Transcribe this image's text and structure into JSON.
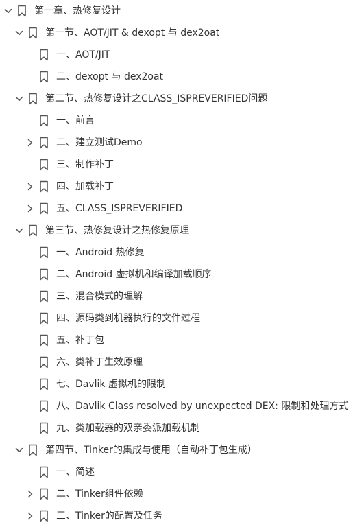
{
  "outline": {
    "items": [
      {
        "label": "第一章、热修复设计",
        "level": 0,
        "toggle": "expanded"
      },
      {
        "label": "第一节、AOT/JIT & dexopt 与 dex2oat",
        "level": 1,
        "toggle": "expanded"
      },
      {
        "label": "一、AOT/JIT",
        "level": 2,
        "toggle": "none"
      },
      {
        "label": "二、dexopt 与 dex2oat",
        "level": 2,
        "toggle": "none"
      },
      {
        "label": "第二节、热修复设计之CLASS_ISPREVERIFIED问题",
        "level": 1,
        "toggle": "expanded"
      },
      {
        "label": "一、前言",
        "level": 2,
        "toggle": "none",
        "underlined": true
      },
      {
        "label": "二、建立测试Demo",
        "level": 2,
        "toggle": "collapsed"
      },
      {
        "label": "三、制作补丁",
        "level": 2,
        "toggle": "none"
      },
      {
        "label": "四、加载补丁",
        "level": 2,
        "toggle": "collapsed"
      },
      {
        "label": "五、CLASS_ISPREVERIFIED",
        "level": 2,
        "toggle": "collapsed"
      },
      {
        "label": "第三节、热修复设计之热修复原理",
        "level": 1,
        "toggle": "expanded"
      },
      {
        "label": "一、Android 热修复",
        "level": 2,
        "toggle": "none"
      },
      {
        "label": "二、Android 虚拟机和编译加载顺序",
        "level": 2,
        "toggle": "none"
      },
      {
        "label": "三、混合模式的理解",
        "level": 2,
        "toggle": "none"
      },
      {
        "label": "四、源码类到机器执行的文件过程",
        "level": 2,
        "toggle": "none"
      },
      {
        "label": "五、补丁包",
        "level": 2,
        "toggle": "none"
      },
      {
        "label": "六、类补丁生效原理",
        "level": 2,
        "toggle": "none"
      },
      {
        "label": "七、Davlik 虚拟机的限制",
        "level": 2,
        "toggle": "none"
      },
      {
        "label": "八、Davlik Class resolved by unexpected DEX: 限制和处理方式",
        "level": 2,
        "toggle": "none"
      },
      {
        "label": "九、类加载器的双亲委派加载机制",
        "level": 2,
        "toggle": "none"
      },
      {
        "label": "第四节、Tinker的集成与使用（自动补丁包生成）",
        "level": 1,
        "toggle": "expanded"
      },
      {
        "label": "一、简述",
        "level": 2,
        "toggle": "none"
      },
      {
        "label": "二、Tinker组件依赖",
        "level": 2,
        "toggle": "collapsed"
      },
      {
        "label": "三、Tinker的配置及任务",
        "level": 2,
        "toggle": "collapsed"
      }
    ]
  },
  "icons": {
    "toggle_expanded": "chevron-down-icon",
    "toggle_collapsed": "chevron-right-icon",
    "item": "bookmark-icon"
  },
  "colors": {
    "text": "#333333",
    "icon": "#555555",
    "background": "#ffffff"
  }
}
